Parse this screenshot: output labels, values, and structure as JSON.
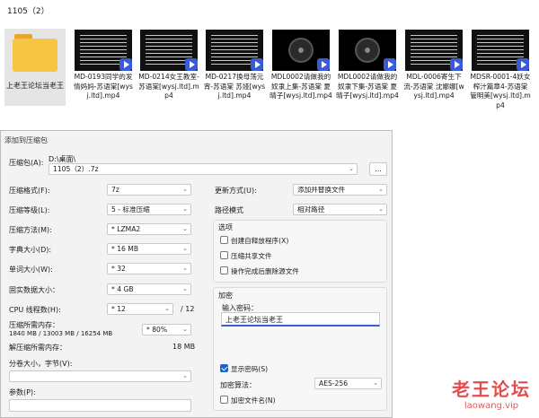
{
  "explorer": {
    "path": "1105（2）",
    "folder": {
      "name": "上老王论坛当老王",
      "icon": "folder-icon"
    },
    "files": [
      {
        "name": "MD-0193同学的发情妈妈-苏语棠[wysj.ltd].mp4",
        "thumb": "text"
      },
      {
        "name": "MD-0214女王教室-苏语棠[wysj.ltd].mp4",
        "thumb": "text"
      },
      {
        "name": "MD-0217换母荡元宵-苏语棠 苏娅[wysj.ltd].mp4",
        "thumb": "text"
      },
      {
        "name": "MDL0002请做我的奴隶上集-苏语棠 夏晴子[wysj.ltd].mp4",
        "thumb": "disc"
      },
      {
        "name": "MDL0002请做我的奴隶下集-苏语棠 夏晴子[wysj.ltd].mp4",
        "thumb": "disc"
      },
      {
        "name": "MDL-0006寄生下流-苏语棠 沈娜娜[wysj.ltd].mp4",
        "thumb": "text"
      },
      {
        "name": "MDSR-0001-4妖女榨汁篇章4-苏语棠 管明美[wysj.ltd].mp4",
        "thumb": "text"
      }
    ]
  },
  "dialog": {
    "title": "添加到压缩包",
    "archive_label": "压缩包(A):",
    "archive_dir": "D:\\桌面\\",
    "archive_name": "1105（2）.7z",
    "browse_label": "...",
    "format_label": "压缩格式(F):",
    "format_value": "7z",
    "level_label": "压缩等级(L):",
    "level_value": "5 - 标准压缩",
    "method_label": "压缩方法(M):",
    "method_value": "* LZMA2",
    "dict_label": "字典大小(D):",
    "dict_value": "* 16 MB",
    "word_label": "单词大小(W):",
    "word_value": "* 32",
    "solid_label": "固实数据大小：",
    "solid_value": "* 4 GB",
    "threads_label": "CPU 线程数(H):",
    "threads_value": "* 12",
    "threads_max": "/ 12",
    "mem_label": "压缩所需内存：",
    "mem_detail": "1840 MB / 13003 MB / 16254 MB",
    "mem_value": "* 80%",
    "decomp_label": "解压缩所需内存：",
    "decomp_value": "18 MB",
    "split_label": "分卷大小，字节(V):",
    "params_label": "参数(P):",
    "update_label": "更新方式(U):",
    "update_value": "添加并替换文件",
    "pathmode_label": "路径模式",
    "pathmode_value": "相对路径",
    "options_title": "选项",
    "opt_sfx": "创建自释放程序(X)",
    "opt_shared": "压缩共享文件",
    "opt_delete": "操作完成后删除源文件",
    "encrypt_title": "加密",
    "password_label": "输入密码：",
    "password_value": "上老王论坛当老王",
    "show_password": "显示密码(S)",
    "enc_method_label": "加密算法：",
    "enc_method_value": "AES-256",
    "encrypt_names": "加密文件名(N)"
  },
  "watermark": {
    "line1": "老王论坛",
    "line2": "laowang.vip"
  }
}
